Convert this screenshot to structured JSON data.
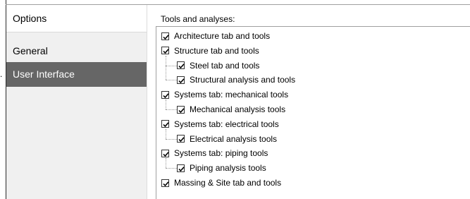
{
  "sidebar": {
    "title": "Options",
    "items": [
      {
        "label": "General",
        "selected": false
      },
      {
        "label": "User Interface",
        "selected": true
      }
    ],
    "selected_bg": "#666666"
  },
  "main": {
    "section_label": "Tools and analyses:",
    "tree": [
      {
        "label": "Architecture tab and tools",
        "checked": true,
        "level": 0
      },
      {
        "label": "Structure tab and tools",
        "checked": true,
        "level": 0
      },
      {
        "label": "Steel tab and tools",
        "checked": true,
        "level": 1
      },
      {
        "label": "Structural analysis and tools",
        "checked": true,
        "level": 1
      },
      {
        "label": "Systems tab: mechanical tools",
        "checked": true,
        "level": 0
      },
      {
        "label": "Mechanical analysis tools",
        "checked": true,
        "level": 1
      },
      {
        "label": "Systems tab: electrical tools",
        "checked": true,
        "level": 0
      },
      {
        "label": "Electrical analysis tools",
        "checked": true,
        "level": 1
      },
      {
        "label": "Systems tab: piping tools",
        "checked": true,
        "level": 0
      },
      {
        "label": "Piping analysis tools",
        "checked": true,
        "level": 1
      },
      {
        "label": "Massing & Site tab and tools",
        "checked": true,
        "level": 0
      }
    ]
  }
}
